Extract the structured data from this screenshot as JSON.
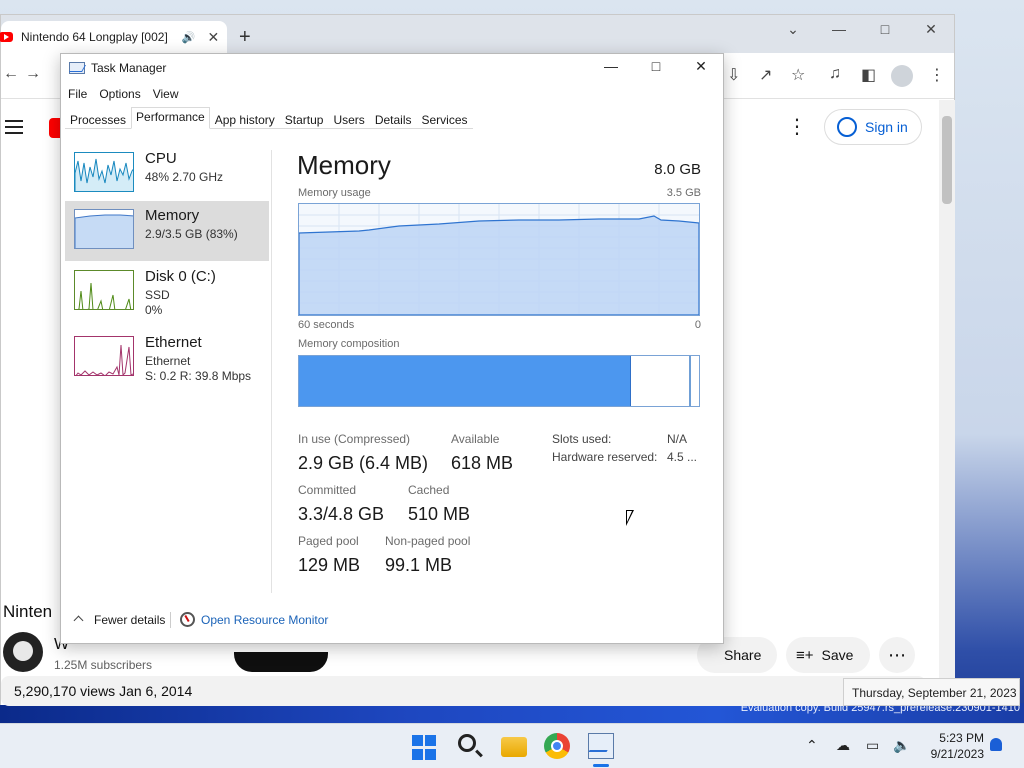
{
  "chrome": {
    "tab_title": "Nintendo 64 Longplay [002]",
    "new_tab_symbol": "+",
    "page": {
      "sign_in_label": "Sign in",
      "video_title_partial": "Ninten",
      "channel_name_partial": "W",
      "channel_subscribers": "1.25M subscribers",
      "share_label": "Share",
      "save_label": "Save",
      "views_text": "5,290,170 views  Jan 6, 2014"
    }
  },
  "task_manager": {
    "title": "Task Manager",
    "menu": [
      "File",
      "Options",
      "View"
    ],
    "tabs": [
      "Processes",
      "Performance",
      "App history",
      "Startup",
      "Users",
      "Details",
      "Services"
    ],
    "active_tab": "Performance",
    "sidebar": [
      {
        "name": "CPU",
        "line1": "48%  2.70 GHz",
        "line2": ""
      },
      {
        "name": "Memory",
        "line1": "2.9/3.5 GB (83%)",
        "line2": ""
      },
      {
        "name": "Disk 0 (C:)",
        "line1": "SSD",
        "line2": "0%"
      },
      {
        "name": "Ethernet",
        "line1": "Ethernet",
        "line2": "S: 0.2  R: 39.8 Mbps"
      }
    ],
    "selected_sidebar": "Memory",
    "memory": {
      "heading": "Memory",
      "total": "8.0 GB",
      "usage_label": "Memory usage",
      "usage_max": "3.5 GB",
      "axis_left": "60 seconds",
      "axis_right": "0",
      "composition_label": "Memory composition",
      "in_use_fraction": 0.83,
      "stats": {
        "in_use_label": "In use (Compressed)",
        "in_use_value": "2.9 GB (6.4 MB)",
        "available_label": "Available",
        "available_value": "618 MB",
        "slots_label": "Slots used:",
        "slots_value": "N/A",
        "hw_reserved_label": "Hardware reserved:",
        "hw_reserved_value": "4.5 ...",
        "committed_label": "Committed",
        "committed_value": "3.3/4.8 GB",
        "cached_label": "Cached",
        "cached_value": "510 MB",
        "paged_label": "Paged pool",
        "paged_value": "129 MB",
        "nonpaged_label": "Non-paged pool",
        "nonpaged_value": "99.1 MB"
      }
    },
    "footer": {
      "fewer_details": "Fewer details",
      "open_resource_monitor": "Open Resource Monitor"
    }
  },
  "desktop": {
    "evaluation_text": "Evaluation copy. Build 25947.rs_prerelease.230901-1410",
    "date_tooltip": "Thursday, September 21, 2023"
  },
  "taskbar": {
    "time": "5:23 PM",
    "date": "9/21/2023",
    "accent": "#1a73e8"
  }
}
